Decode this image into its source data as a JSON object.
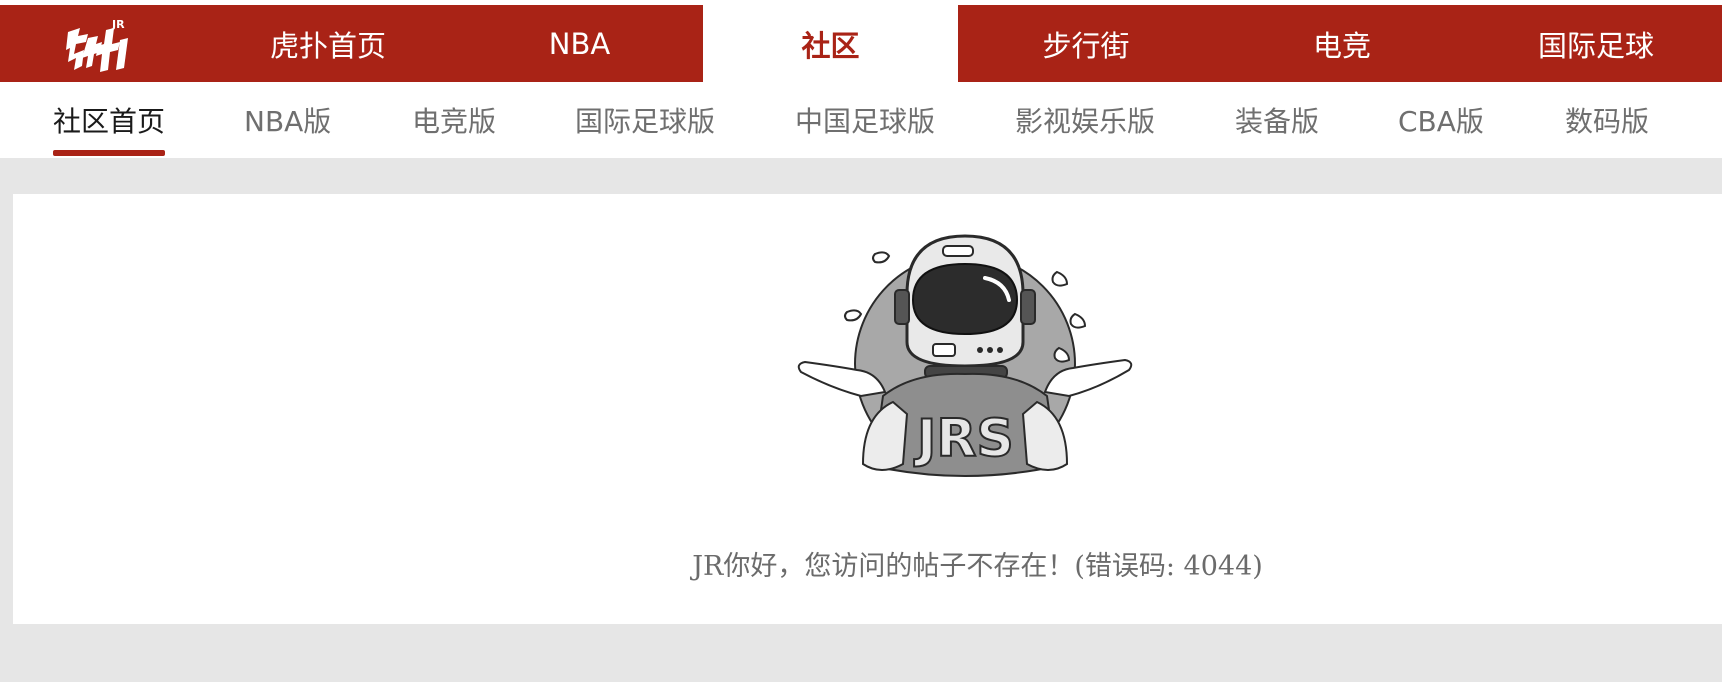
{
  "top_nav": {
    "logo_alt": "虎扑",
    "items": [
      {
        "label": "虎扑首页",
        "active": false
      },
      {
        "label": "NBA",
        "active": false
      },
      {
        "label": "社区",
        "active": true
      },
      {
        "label": "步行街",
        "active": false
      },
      {
        "label": "电竞",
        "active": false
      },
      {
        "label": "国际足球",
        "active": false
      }
    ],
    "color_primary": "#a92316"
  },
  "sub_nav": {
    "items": [
      {
        "label": "社区首页",
        "active": true
      },
      {
        "label": "NBA版",
        "active": false
      },
      {
        "label": "电竞版",
        "active": false
      },
      {
        "label": "国际足球版",
        "active": false
      },
      {
        "label": "中国足球版",
        "active": false
      },
      {
        "label": "影视娱乐版",
        "active": false
      },
      {
        "label": "装备版",
        "active": false
      },
      {
        "label": "CBA版",
        "active": false
      },
      {
        "label": "数码版",
        "active": false
      }
    ]
  },
  "error": {
    "illustration": "astronaut-shrug-icon",
    "shirt_text": "JRS",
    "message": "JR你好，您访问的帖子不存在！(错误码: 4044)"
  }
}
